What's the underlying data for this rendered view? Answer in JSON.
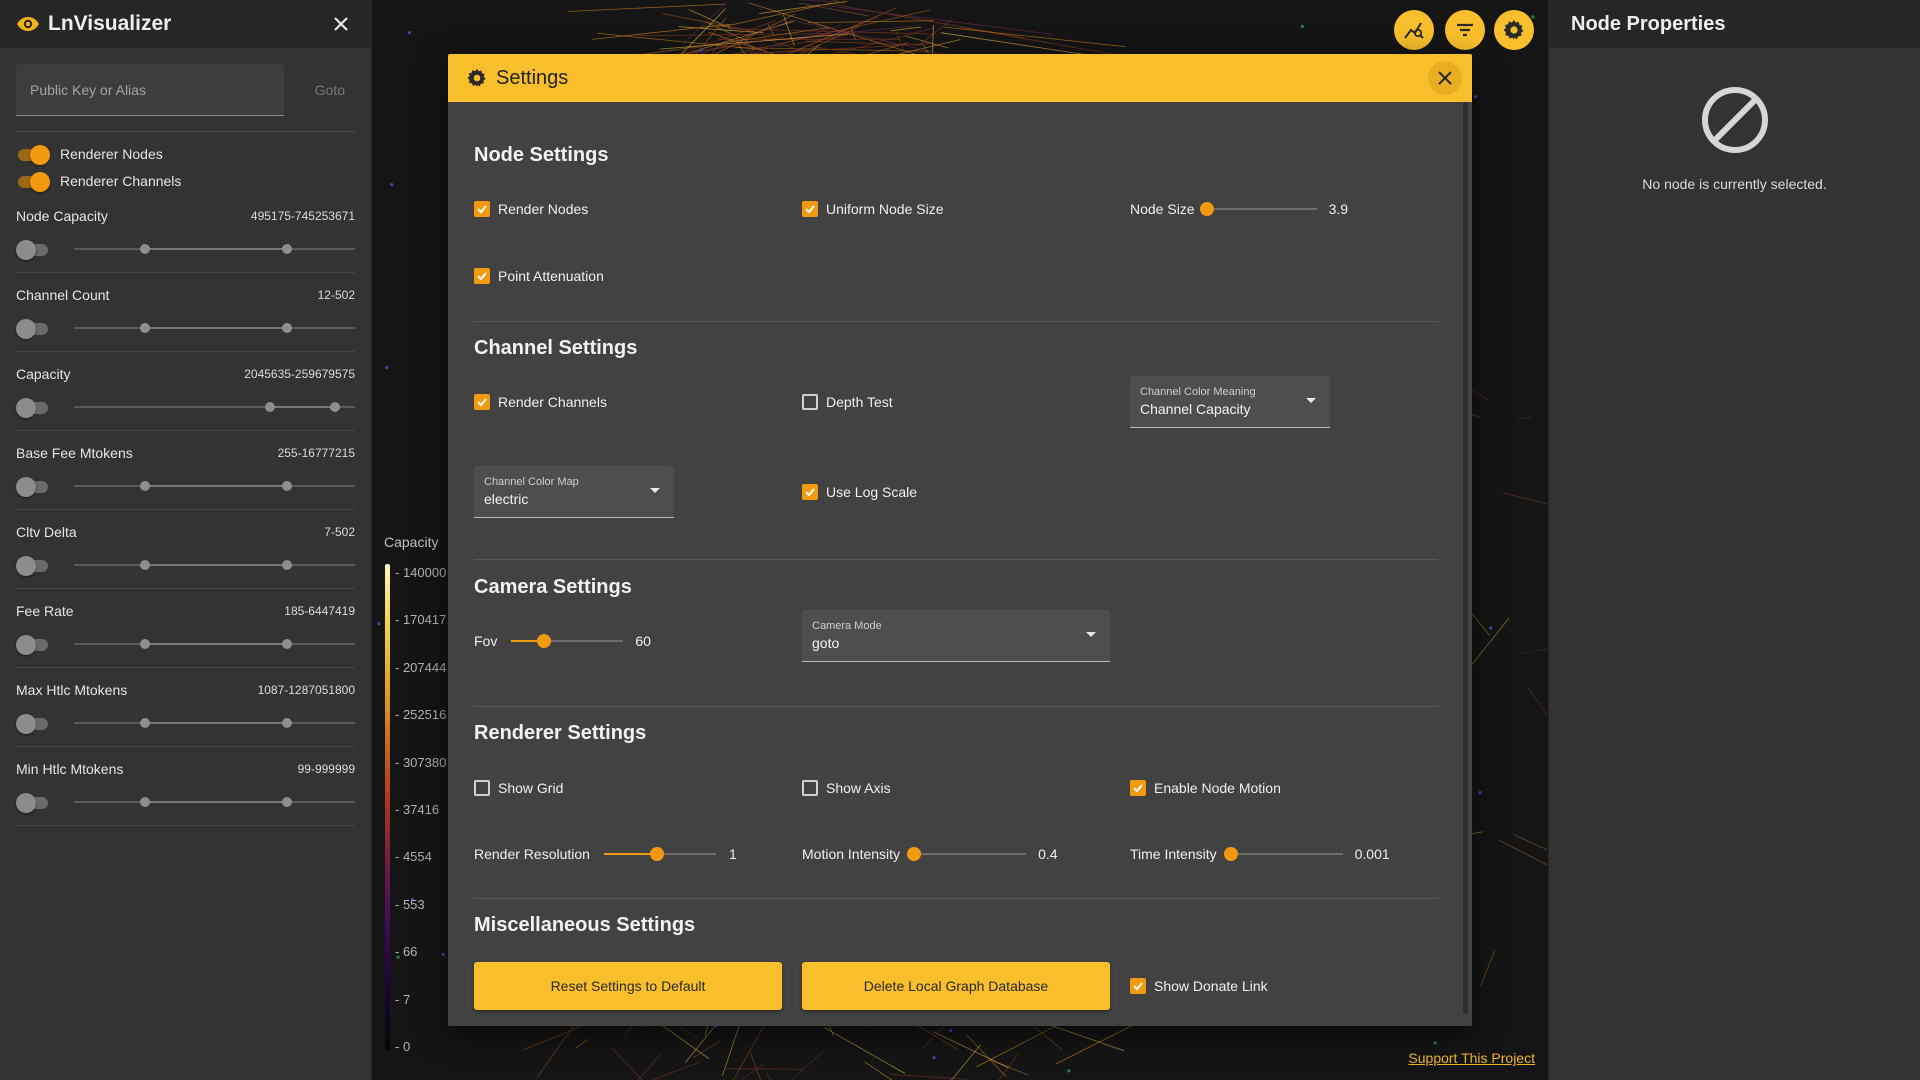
{
  "sidebar": {
    "title": "LnVisualizer",
    "search_placeholder": "Public Key or Alias",
    "goto_label": "Goto",
    "toggles": [
      {
        "label": "Renderer Nodes",
        "on": true
      },
      {
        "label": "Renderer Channels",
        "on": true
      }
    ],
    "filters": [
      {
        "name": "Node Capacity",
        "range": "495175-745253671",
        "enabled": false,
        "low": 0.25,
        "high": 0.75
      },
      {
        "name": "Channel Count",
        "range": "12-502",
        "enabled": false,
        "low": 0.25,
        "high": 0.75
      },
      {
        "name": "Capacity",
        "range": "2045635-259679575",
        "enabled": false,
        "low": 0.69,
        "high": 0.92
      },
      {
        "name": "Base Fee Mtokens",
        "range": "255-16777215",
        "enabled": false,
        "low": 0.25,
        "high": 0.75
      },
      {
        "name": "Cltv Delta",
        "range": "7-502",
        "enabled": false,
        "low": 0.25,
        "high": 0.75
      },
      {
        "name": "Fee Rate",
        "range": "185-6447419",
        "enabled": false,
        "low": 0.25,
        "high": 0.75
      },
      {
        "name": "Max Htlc Mtokens",
        "range": "1087-1287051800",
        "enabled": false,
        "low": 0.25,
        "high": 0.75
      },
      {
        "name": "Min Htlc Mtokens",
        "range": "99-999999",
        "enabled": false,
        "low": 0.25,
        "high": 0.75
      }
    ]
  },
  "legend": {
    "title": "Capacity",
    "ticks": [
      "- 140000",
      "- 170417",
      "- 207444",
      "- 252516",
      "- 307380",
      "- 37416",
      "- 4554",
      "- 553",
      "- 66",
      "- 7",
      "- 0"
    ]
  },
  "support_link": "Support This Project",
  "properties": {
    "title": "Node Properties",
    "empty_message": "No node is currently selected."
  },
  "settings": {
    "title": "Settings",
    "node": {
      "title": "Node Settings",
      "render_nodes": {
        "label": "Render Nodes",
        "checked": true
      },
      "uniform_size": {
        "label": "Uniform Node Size",
        "checked": true
      },
      "node_size": {
        "label": "Node Size",
        "value": "3.9",
        "fraction": 0.0
      },
      "point_attenuation": {
        "label": "Point Attenuation",
        "checked": true
      }
    },
    "channel": {
      "title": "Channel Settings",
      "render_channels": {
        "label": "Render Channels",
        "checked": true
      },
      "depth_test": {
        "label": "Depth Test",
        "checked": false
      },
      "color_meaning": {
        "label": "Channel Color Meaning",
        "value": "Channel Capacity"
      },
      "color_map": {
        "label": "Channel Color Map",
        "value": "electric"
      },
      "log_scale": {
        "label": "Use Log Scale",
        "checked": true
      }
    },
    "camera": {
      "title": "Camera Settings",
      "fov": {
        "label": "Fov",
        "value": "60",
        "fraction": 0.29
      },
      "mode": {
        "label": "Camera Mode",
        "value": "goto"
      }
    },
    "renderer": {
      "title": "Renderer Settings",
      "show_grid": {
        "label": "Show Grid",
        "checked": false
      },
      "show_axis": {
        "label": "Show Axis",
        "checked": false
      },
      "node_motion": {
        "label": "Enable Node Motion",
        "checked": true
      },
      "resolution": {
        "label": "Render Resolution",
        "value": "1",
        "fraction": 0.47
      },
      "motion_intensity": {
        "label": "Motion Intensity",
        "value": "0.4",
        "fraction": 0.0
      },
      "time_intensity": {
        "label": "Time Intensity",
        "value": "0.001",
        "fraction": 0.0
      }
    },
    "misc": {
      "title": "Miscellaneous Settings",
      "reset_label": "Reset Settings to Default",
      "delete_label": "Delete Local Graph Database",
      "donate": {
        "label": "Show Donate Link",
        "checked": true
      }
    }
  },
  "colors": {
    "accent": "#f8be2c",
    "toggle": "#f29a0f",
    "panel": "#333333",
    "modal": "#424242"
  },
  "icons": [
    "eye-logo-icon",
    "close-icon",
    "graph-search-icon",
    "filter-icon",
    "gear-icon",
    "no-selection-icon",
    "checkmark-icon",
    "dropdown-arrow-icon"
  ]
}
